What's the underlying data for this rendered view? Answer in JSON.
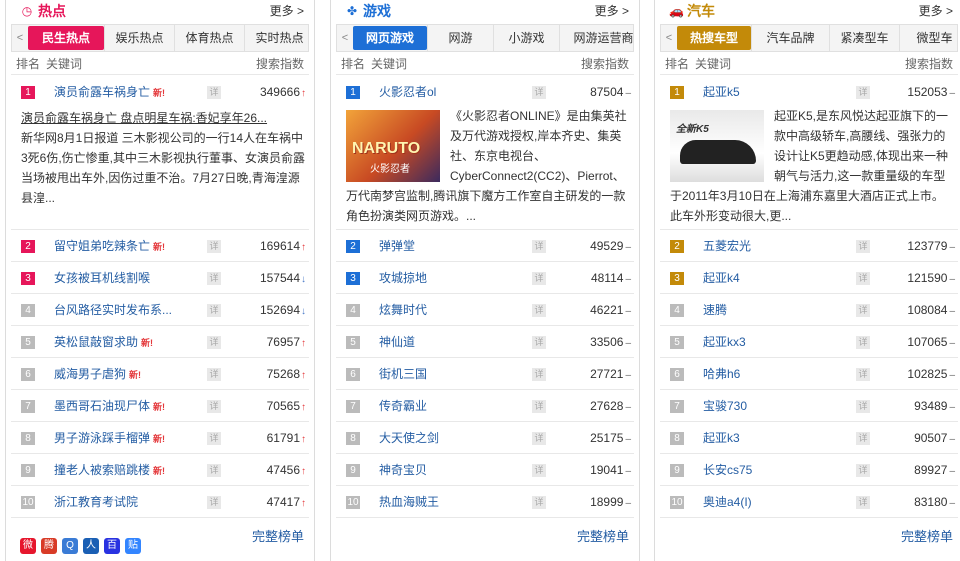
{
  "more_label": "更多 >",
  "detail_label": "详",
  "full_list_label": "完整榜单",
  "headers": {
    "rank": "排名",
    "keyword": "关键词",
    "index": "搜索指数"
  },
  "share_icons": [
    {
      "name": "weibo-share-icon",
      "glyph": "微",
      "color": "#e6162d"
    },
    {
      "name": "tencent-weibo-share-icon",
      "glyph": "腾",
      "color": "#d83b27"
    },
    {
      "name": "qzone-share-icon",
      "glyph": "Q",
      "color": "#3a7bd5"
    },
    {
      "name": "renren-share-icon",
      "glyph": "人",
      "color": "#1a5fb4"
    },
    {
      "name": "baidu-share-icon",
      "glyph": "百",
      "color": "#2932e1"
    },
    {
      "name": "tieba-share-icon",
      "glyph": "贴",
      "color": "#3385ff"
    }
  ],
  "panels": [
    {
      "title": "热点",
      "accent": "#e6165a",
      "icon": "clock-icon",
      "icon_glyph": "◷",
      "tabs": [
        "民生热点",
        "娱乐热点",
        "体育热点",
        "实时热点"
      ],
      "active_tab": 0,
      "top": {
        "keyword": "演员俞露车祸身亡",
        "new": true,
        "value": "349666",
        "trend": "up",
        "link": "演员俞露车祸身亡 盘点明星车祸:香妃享年26...",
        "text": "新华网8月1日报道 三木影视公司的一行14人在车祸中3死6伤,伤亡惨重,其中三木影视执行董事、女演员俞露当场被甩出车外,因伤过重不治。7月27日晚,青海湟源县湟..."
      },
      "rows": [
        {
          "rank": "2",
          "keyword": "留守姐弟吃辣条亡",
          "new": true,
          "value": "169614",
          "trend": "up"
        },
        {
          "rank": "3",
          "keyword": "女孩被耳机线割喉",
          "new": false,
          "value": "157544",
          "trend": "down"
        },
        {
          "rank": "4",
          "keyword": "台风路径实时发布系...",
          "new": false,
          "value": "152694",
          "trend": "down"
        },
        {
          "rank": "5",
          "keyword": "英松鼠敲窗求助",
          "new": true,
          "value": "76957",
          "trend": "up"
        },
        {
          "rank": "6",
          "keyword": "威海男子虐狗",
          "new": true,
          "value": "75268",
          "trend": "up"
        },
        {
          "rank": "7",
          "keyword": "墨西哥石油现尸体",
          "new": true,
          "value": "70565",
          "trend": "up"
        },
        {
          "rank": "8",
          "keyword": "男子游泳踩手榴弹",
          "new": true,
          "value": "61791",
          "trend": "up"
        },
        {
          "rank": "9",
          "keyword": "撞老人被索赔跳楼",
          "new": true,
          "value": "47456",
          "trend": "up"
        },
        {
          "rank": "10",
          "keyword": "浙江教育考试院",
          "new": false,
          "value": "47417",
          "trend": "up"
        }
      ]
    },
    {
      "title": "游戏",
      "accent": "#1d6fd6",
      "icon": "gamepad-icon",
      "icon_glyph": "✤",
      "tabs": [
        "网页游戏",
        "网游",
        "小游戏",
        "网游运营商"
      ],
      "active_tab": 0,
      "top": {
        "keyword": "火影忍者ol",
        "new": false,
        "value": "87504",
        "trend": "flat",
        "thumb_label": "NARUTO",
        "thumb_sub": "火影忍者",
        "text": "《火影忍者ONLINE》是由集英社及万代游戏授权,岸本齐史、集英社、东京电视台、CyberConnect2(CC2)、Pierrot、万代南梦宫监制,腾讯旗下魔方工作室自主研发的一款角色扮演类网页游戏。..."
      },
      "rows": [
        {
          "rank": "2",
          "keyword": "弹弹堂",
          "new": false,
          "value": "49529",
          "trend": "flat"
        },
        {
          "rank": "3",
          "keyword": "攻城掠地",
          "new": false,
          "value": "48114",
          "trend": "flat"
        },
        {
          "rank": "4",
          "keyword": "炫舞时代",
          "new": false,
          "value": "46221",
          "trend": "flat"
        },
        {
          "rank": "5",
          "keyword": "神仙道",
          "new": false,
          "value": "33506",
          "trend": "flat"
        },
        {
          "rank": "6",
          "keyword": "街机三国",
          "new": false,
          "value": "27721",
          "trend": "flat"
        },
        {
          "rank": "7",
          "keyword": "传奇霸业",
          "new": false,
          "value": "27628",
          "trend": "flat"
        },
        {
          "rank": "8",
          "keyword": "大天使之剑",
          "new": false,
          "value": "25175",
          "trend": "flat"
        },
        {
          "rank": "9",
          "keyword": "神奇宝贝",
          "new": false,
          "value": "19041",
          "trend": "flat"
        },
        {
          "rank": "10",
          "keyword": "热血海贼王",
          "new": false,
          "value": "18999",
          "trend": "flat"
        }
      ]
    },
    {
      "title": "汽车",
      "accent": "#c38a09",
      "icon": "car-icon",
      "icon_glyph": "🚗",
      "tabs": [
        "热搜车型",
        "汽车品牌",
        "紧凑型车",
        "微型车"
      ],
      "active_tab": 0,
      "top": {
        "keyword": "起亚k5",
        "new": false,
        "value": "152053",
        "trend": "flat",
        "thumb_label": "全新K5",
        "text": "起亚K5,是东风悦达起亚旗下的一款中高级轿车,高腰线、强张力的设计让K5更趋动感,体现出来一种朝气与活力,这一款重量级的车型于2011年3月10日在上海浦东嘉里大酒店正式上市。此车外形变动很大,更..."
      },
      "rows": [
        {
          "rank": "2",
          "keyword": "五菱宏光",
          "new": false,
          "value": "123779",
          "trend": "flat"
        },
        {
          "rank": "3",
          "keyword": "起亚k4",
          "new": false,
          "value": "121590",
          "trend": "flat"
        },
        {
          "rank": "4",
          "keyword": "速腾",
          "new": false,
          "value": "108084",
          "trend": "flat"
        },
        {
          "rank": "5",
          "keyword": "起亚kx3",
          "new": false,
          "value": "107065",
          "trend": "flat"
        },
        {
          "rank": "6",
          "keyword": "哈弗h6",
          "new": false,
          "value": "102825",
          "trend": "flat"
        },
        {
          "rank": "7",
          "keyword": "宝骏730",
          "new": false,
          "value": "93489",
          "trend": "flat"
        },
        {
          "rank": "8",
          "keyword": "起亚k3",
          "new": false,
          "value": "90507",
          "trend": "flat"
        },
        {
          "rank": "9",
          "keyword": "长安cs75",
          "new": false,
          "value": "89927",
          "trend": "flat"
        },
        {
          "rank": "10",
          "keyword": "奥迪a4(I)",
          "new": false,
          "value": "83180",
          "trend": "flat"
        }
      ]
    }
  ]
}
